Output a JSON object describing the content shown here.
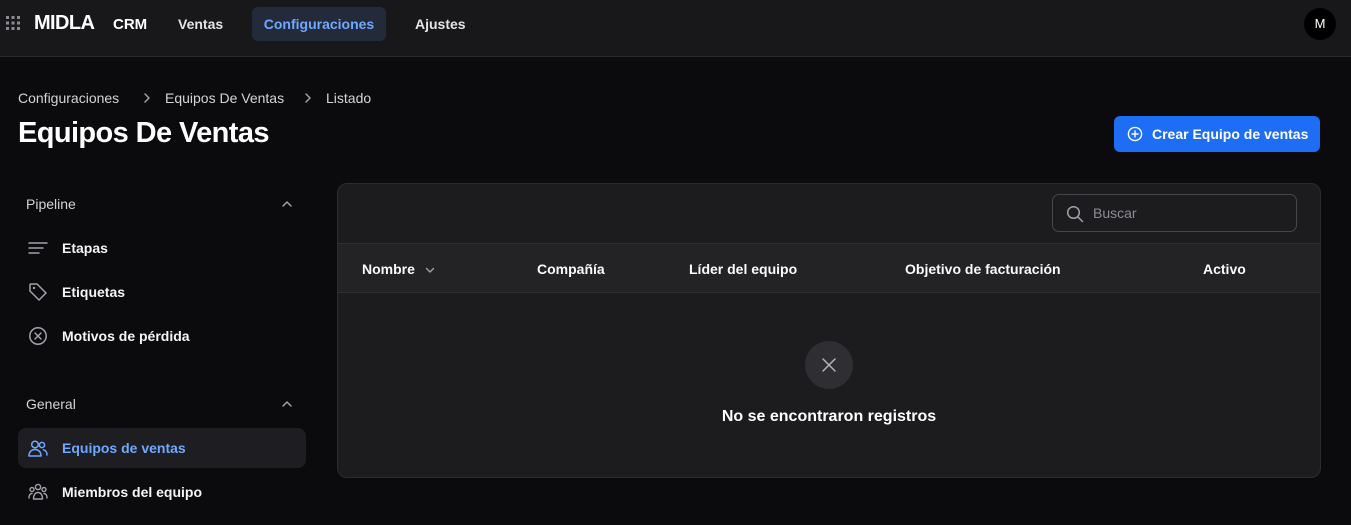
{
  "header": {
    "brand": "MIDLA",
    "app": "CRM",
    "nav": [
      {
        "label": "Ventas"
      },
      {
        "label": "Configuraciones"
      },
      {
        "label": "Ajustes"
      }
    ],
    "avatar_initial": "M"
  },
  "breadcrumb": {
    "items": [
      "Configuraciones",
      "Equipos De Ventas",
      "Listado"
    ],
    "separator": ">"
  },
  "page": {
    "title": "Equipos De Ventas",
    "create_button": "Crear Equipo de ventas"
  },
  "sidebar": {
    "sections": [
      {
        "label": "Pipeline",
        "items": [
          {
            "label": "Etapas",
            "icon": "lines-icon"
          },
          {
            "label": "Etiquetas",
            "icon": "tag-icon"
          },
          {
            "label": "Motivos de pérdida",
            "icon": "circle-x-icon"
          }
        ]
      },
      {
        "label": "General",
        "items": [
          {
            "label": "Equipos de ventas",
            "icon": "users-icon",
            "active": true
          },
          {
            "label": "Miembros del equipo",
            "icon": "group-icon"
          }
        ]
      }
    ]
  },
  "table": {
    "search_placeholder": "Buscar",
    "columns": [
      "Nombre",
      "Compañía",
      "Líder del equipo",
      "Objetivo de facturación",
      "Activo"
    ],
    "sorted_column": "Nombre",
    "rows": [],
    "empty_message": "No se encontraron registros"
  },
  "colors": {
    "accent": "#1d6df5",
    "active_nav_text": "#6ea8ff",
    "background": "#0b0b0d",
    "panel": "#1c1c1f"
  }
}
